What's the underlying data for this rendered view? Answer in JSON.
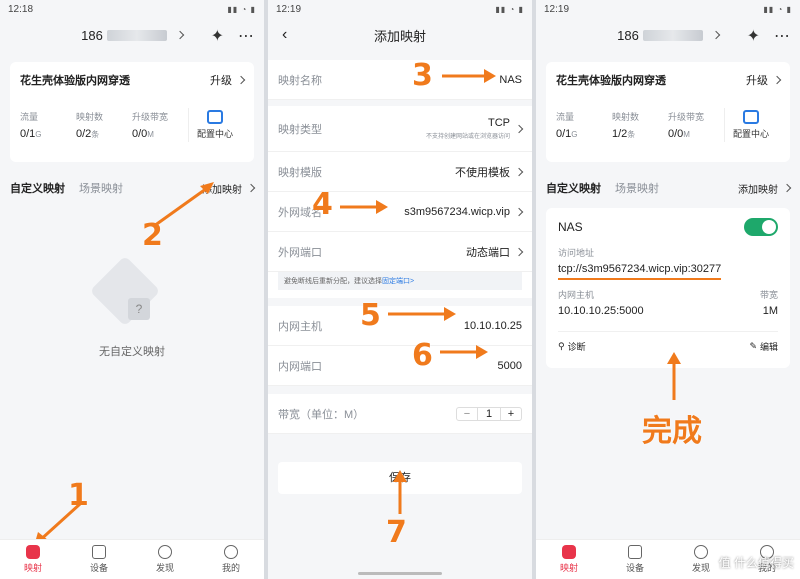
{
  "screen1": {
    "time": "12:18",
    "phone_prefix": "186",
    "card_title": "花生壳体验版内网穿透",
    "upgrade": "升级",
    "stats": [
      {
        "label": "流量",
        "value": "0/1",
        "unit": "G"
      },
      {
        "label": "映射数",
        "value": "0/2",
        "unit": "条"
      },
      {
        "label": "升级带宽",
        "value": "0/0",
        "unit": "M"
      }
    ],
    "config_center": "配置中心",
    "tab_custom": "自定义映射",
    "tab_scene": "场景映射",
    "add_mapping": "添加映射",
    "empty_text": "无自定义映射",
    "step1": "1",
    "step2": "2",
    "bottom_tabs": [
      "映射",
      "设备",
      "发现",
      "我的"
    ]
  },
  "screen2": {
    "time": "12:19",
    "title": "添加映射",
    "fields": {
      "name_label": "映射名称",
      "name_value": "NAS",
      "type_label": "映射类型",
      "type_value": "TCP",
      "type_note": "不支持创建网站或在浏览器访问",
      "template_label": "映射模版",
      "template_value": "不使用模板",
      "domain_label": "外网域名",
      "domain_value": "s3m9567234.wicp.vip",
      "port_label": "外网端口",
      "port_value": "动态端口",
      "notice": "避免断线后重新分配，建议选择",
      "notice_link": "固定端口>",
      "host_label": "内网主机",
      "host_value": "10.10.10.25",
      "inport_label": "内网端口",
      "inport_value": "5000",
      "bw_label": "带宽（单位：M）",
      "bw_value": "1",
      "minus": "−",
      "plus": "+"
    },
    "save": "保存",
    "steps": {
      "s3": "3",
      "s4": "4",
      "s5": "5",
      "s6": "6",
      "s7": "7"
    }
  },
  "screen3": {
    "time": "12:19",
    "phone_prefix": "186",
    "card_title": "花生壳体验版内网穿透",
    "upgrade": "升级",
    "stats": [
      {
        "label": "流量",
        "value": "0/1",
        "unit": "G"
      },
      {
        "label": "映射数",
        "value": "1/2",
        "unit": "条"
      },
      {
        "label": "升级带宽",
        "value": "0/0",
        "unit": "M"
      }
    ],
    "config_center": "配置中心",
    "tab_custom": "自定义映射",
    "tab_scene": "场景映射",
    "add_mapping": "添加映射",
    "mapping": {
      "name": "NAS",
      "addr_label": "访问地址",
      "addr_value": "tcp://s3m9567234.wicp.vip:30277",
      "host_label": "内网主机",
      "host_value": "10.10.10.25:5000",
      "bw_label": "带宽",
      "bw_value": "1M",
      "diagnose": "诊断",
      "edit": "编辑"
    },
    "done": "完成",
    "bottom_tabs": [
      "映射",
      "设备",
      "发现",
      "我的"
    ],
    "watermark": "值 什么值得买"
  },
  "colors": {
    "accent": "#f07a1c",
    "brand": "#e8344a",
    "toggle": "#1ea86b",
    "link": "#2a7ae2"
  }
}
